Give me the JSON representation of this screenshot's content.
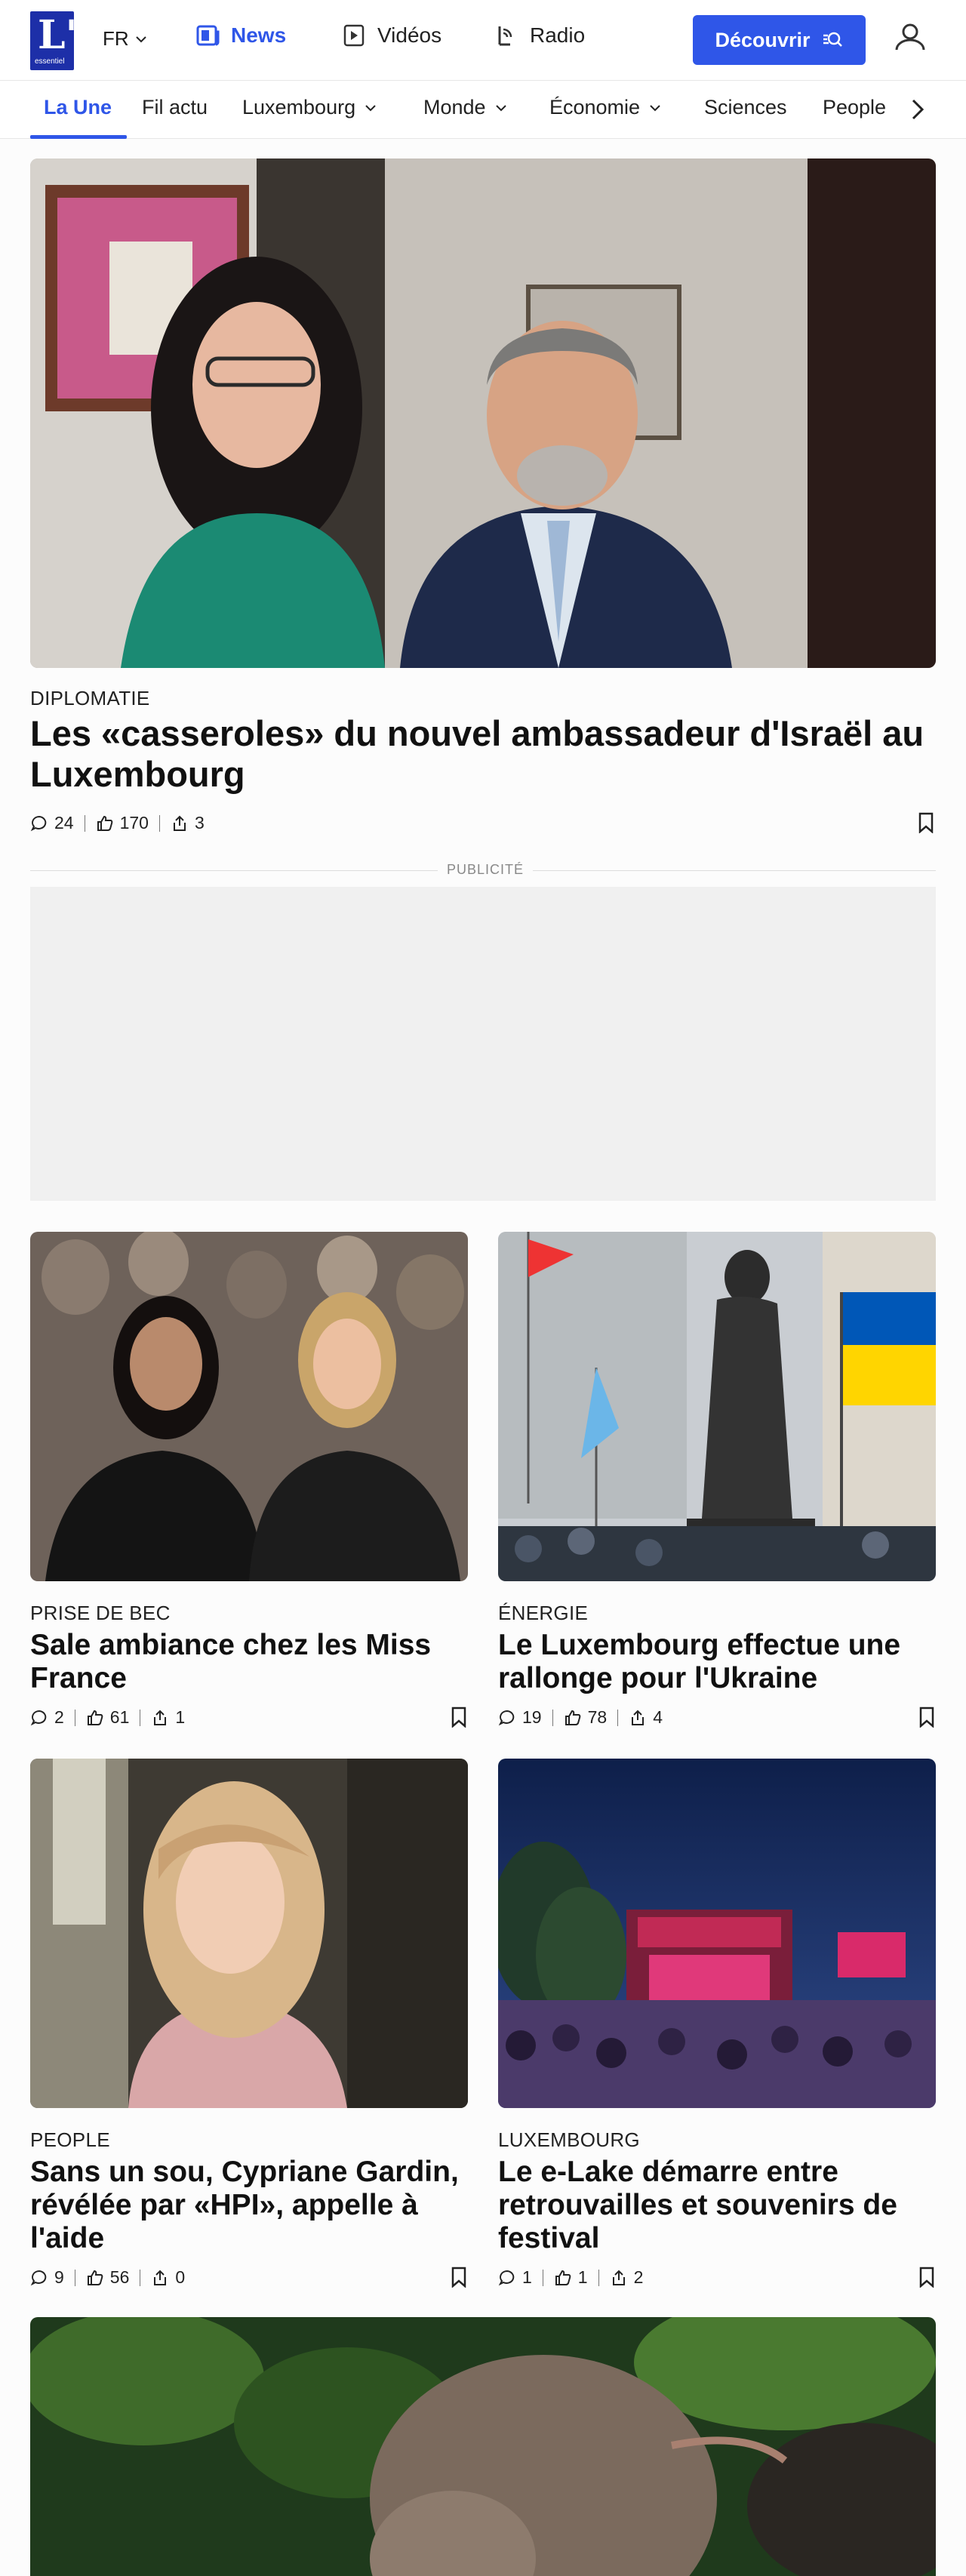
{
  "header": {
    "logo_text": "L'",
    "logo_sub": "essentiel",
    "language": "FR",
    "nav": [
      {
        "label": "News",
        "icon": "news-icon",
        "active": true
      },
      {
        "label": "Vidéos",
        "icon": "play-icon"
      },
      {
        "label": "Radio",
        "icon": "radio-icon"
      }
    ],
    "discover_label": "Découvrir",
    "accent_color": "#2f56e8",
    "logo_color": "#1d2fa8"
  },
  "categories": [
    {
      "label": "La Une",
      "active": true
    },
    {
      "label": "Fil actu"
    },
    {
      "label": "Luxembourg",
      "dropdown": true
    },
    {
      "label": "Monde",
      "dropdown": true
    },
    {
      "label": "Économie",
      "dropdown": true
    },
    {
      "label": "Sciences"
    },
    {
      "label": "People"
    }
  ],
  "hero": {
    "rubric": "DIPLOMATIE",
    "title": "Les «casseroles» du nouvel ambassadeur d'Israël au Luxembourg",
    "comments": "24",
    "likes": "170",
    "shares": "3"
  },
  "ad": {
    "label": "PUBLICITÉ"
  },
  "articles": [
    {
      "rubric": "PRISE DE BEC",
      "title": "Sale ambiance chez les Miss France",
      "comments": "2",
      "likes": "61",
      "shares": "1"
    },
    {
      "rubric": "ÉNERGIE",
      "title": "Le Luxembourg effectue une rallonge pour l'Ukraine",
      "comments": "19",
      "likes": "78",
      "shares": "4"
    },
    {
      "rubric": "PEOPLE",
      "title": "Sans un sou, Cypriane Gardin, révélée par «HPI», appelle à l'aide",
      "comments": "9",
      "likes": "56",
      "shares": "0"
    },
    {
      "rubric": "LUXEMBOURG",
      "title": "Le e-Lake démarre entre retrouvailles et souvenirs de festival",
      "comments": "1",
      "likes": "1",
      "shares": "2"
    }
  ]
}
